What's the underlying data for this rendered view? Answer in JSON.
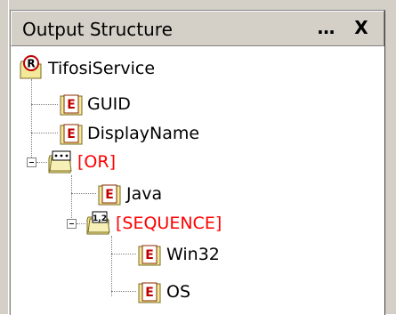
{
  "window": {
    "title": "Output Structure",
    "more_label": "...",
    "close_label": "X"
  },
  "tree": {
    "root": {
      "label": "TifosiService",
      "icon": "R",
      "color": "#000000"
    },
    "guid": {
      "label": "GUID",
      "icon": "E",
      "color": "#000000"
    },
    "display_name": {
      "label": "DisplayName",
      "icon": "E",
      "color": "#000000"
    },
    "or_group": {
      "label": "[OR]",
      "icon": "OR-group-icon",
      "color": "#ff0000"
    },
    "java": {
      "label": "Java",
      "icon": "E",
      "color": "#000000"
    },
    "sequence_group": {
      "label": "[SEQUENCE]",
      "icon": "1,2",
      "color": "#ff0000"
    },
    "win32": {
      "label": "Win32",
      "icon": "E",
      "color": "#000000"
    },
    "os": {
      "label": "OS",
      "icon": "E",
      "color": "#000000"
    }
  }
}
